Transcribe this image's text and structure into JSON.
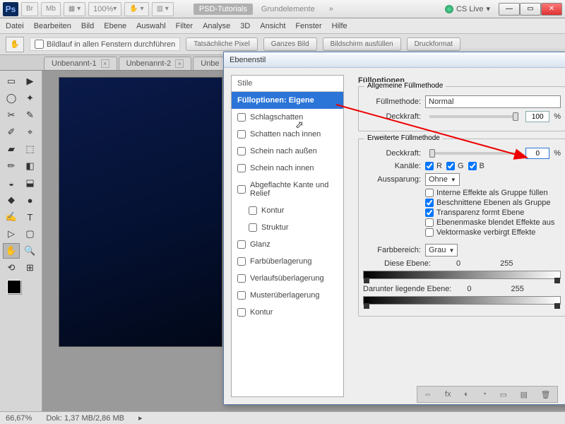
{
  "titlebar": {
    "logo": "Ps",
    "quick": [
      "Br",
      "Mb"
    ],
    "zoom": "100%",
    "central": [
      "PSD-Tutorials",
      "Grundelemente"
    ],
    "cs_live": "CS Live"
  },
  "menu": [
    "Datei",
    "Bearbeiten",
    "Bild",
    "Ebene",
    "Auswahl",
    "Filter",
    "Analyse",
    "3D",
    "Ansicht",
    "Fenster",
    "Hilfe"
  ],
  "optbar": {
    "scroll_all": "Bildlauf in allen Fenstern durchführen",
    "btns": [
      "Tatsächliche Pixel",
      "Ganzes Bild",
      "Bildschirm ausfüllen",
      "Druckformat"
    ]
  },
  "tabs": [
    "Unbenannt-1",
    "Unbenannt-2",
    "Unbe"
  ],
  "tools": [
    "▭",
    "▶",
    "◯",
    "✦",
    "✂",
    "✎",
    "✐",
    "⌖",
    "▰",
    "⬚",
    "✏",
    "◧",
    "◒",
    "⬓",
    "◆",
    "●",
    "✍",
    "T",
    "▷",
    "▢",
    "✋",
    "🔍",
    "⟲",
    "⊞"
  ],
  "status": {
    "zoom": "66,67%",
    "doksize": "Dok: 1,37 MB/2,86 MB"
  },
  "dialog": {
    "title": "Ebenenstil",
    "header": "Stile",
    "items": [
      {
        "label": "Fülloptionen: Eigene",
        "hi": true,
        "chk": false
      },
      {
        "label": "Schlagschatten",
        "chk": true
      },
      {
        "label": "Schatten nach innen",
        "chk": true
      },
      {
        "label": "Schein nach außen",
        "chk": true
      },
      {
        "label": "Schein nach innen",
        "chk": true
      },
      {
        "label": "Abgeflachte Kante und Relief",
        "chk": true
      },
      {
        "label": "Kontur",
        "chk": true,
        "sub": true
      },
      {
        "label": "Struktur",
        "chk": true,
        "sub": true
      },
      {
        "label": "Glanz",
        "chk": true
      },
      {
        "label": "Farbüberlagerung",
        "chk": true
      },
      {
        "label": "Verlaufsüberlagerung",
        "chk": true
      },
      {
        "label": "Musterüberlagerung",
        "chk": true
      },
      {
        "label": "Kontur",
        "chk": true
      }
    ],
    "right": {
      "heading": "Fülloptionen",
      "general_legend": "Allgemeine Füllmethode",
      "blend_label": "Füllmethode:",
      "blend_value": "Normal",
      "opacity_label": "Deckkraft:",
      "opacity_value": "100",
      "adv_legend": "Erweiterte Füllmethode",
      "fill_opacity_label": "Deckkraft:",
      "fill_opacity_value": "0",
      "channels_label": "Kanäle:",
      "ch_r": "R",
      "ch_g": "G",
      "ch_b": "B",
      "knockout_label": "Aussparung:",
      "knockout_value": "Ohne",
      "opts": [
        {
          "on": false,
          "label": "Interne Effekte als Gruppe füllen"
        },
        {
          "on": true,
          "label": "Beschnittene Ebenen als Gruppe"
        },
        {
          "on": true,
          "label": "Transparenz formt Ebene"
        },
        {
          "on": false,
          "label": "Ebenenmaske blendet Effekte aus"
        },
        {
          "on": false,
          "label": "Vektormaske verbirgt Effekte"
        }
      ],
      "blendif_label": "Farbbereich:",
      "blendif_value": "Grau",
      "this_layer": "Diese Ebene:",
      "under_layer": "Darunter liegende Ebene:",
      "v0": "0",
      "v255": "255"
    }
  },
  "bottom_icons": [
    "⇔",
    "fx",
    "◐",
    "◔",
    "▭",
    "▤",
    "🗑"
  ]
}
